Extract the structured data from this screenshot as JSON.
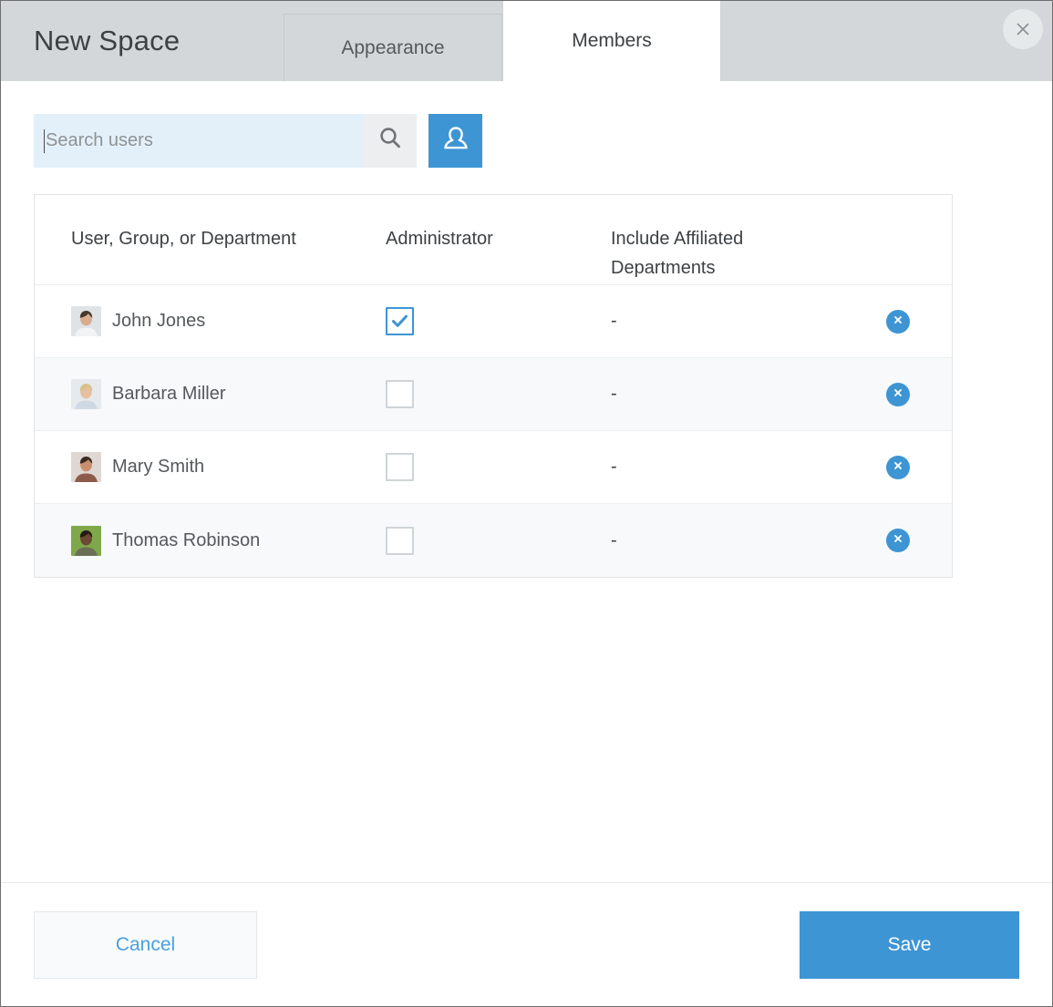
{
  "dialog": {
    "title": "New Space",
    "close_label": "×"
  },
  "tabs": [
    {
      "label": "Appearance",
      "active": false
    },
    {
      "label": "Members",
      "active": true
    }
  ],
  "search": {
    "placeholder": "Search users",
    "value": "",
    "search_icon": "search-icon",
    "add_user_icon": "person-icon"
  },
  "table": {
    "headers": {
      "user": "User, Group, or Department",
      "administrator": "Administrator",
      "include_affiliated_line1": "Include Affiliated",
      "include_affiliated_line2": "Departments"
    },
    "rows": [
      {
        "name": "John Jones",
        "administrator": true,
        "include_affiliated": "-",
        "remove_label": "×"
      },
      {
        "name": "Barbara Miller",
        "administrator": false,
        "include_affiliated": "-",
        "remove_label": "×"
      },
      {
        "name": "Mary Smith",
        "administrator": false,
        "include_affiliated": "-",
        "remove_label": "×"
      },
      {
        "name": "Thomas Robinson",
        "administrator": false,
        "include_affiliated": "-",
        "remove_label": "×"
      }
    ]
  },
  "footer": {
    "cancel_label": "Cancel",
    "save_label": "Save"
  },
  "colors": {
    "accent_blue": "#3d95d4",
    "header_gray": "#d3d7d9",
    "search_field_blue": "#e3f0fa",
    "row_alt": "#f7f9fa",
    "link_blue": "#4a9fe0"
  }
}
